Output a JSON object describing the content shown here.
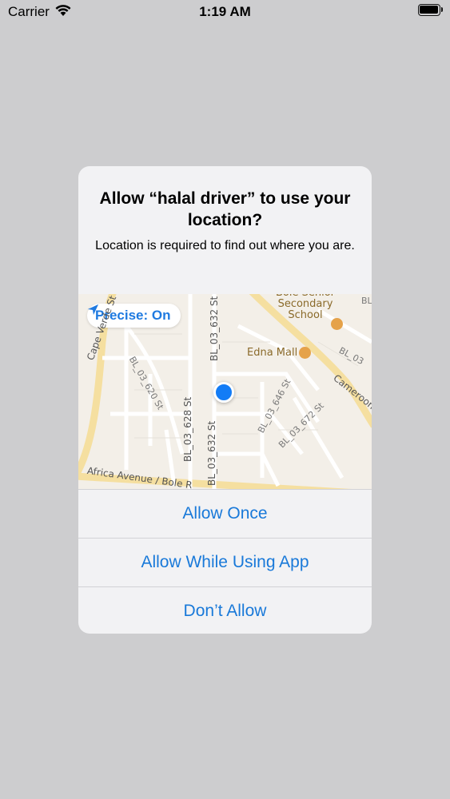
{
  "status_bar": {
    "carrier": "Carrier",
    "time": "1:19 AM",
    "icons": [
      "wifi-icon",
      "battery-icon"
    ]
  },
  "alert": {
    "title": "Allow “halal driver” to use your location?",
    "message": "Location is required to find out where you are.",
    "precise_label": "Precise: On",
    "accent_color": "#1979d9",
    "map": {
      "streets": [
        "Cape Verde St",
        "BL_03_620 St",
        "BL_03_628 St",
        "BL_03_632 St",
        "BL_03_632 St",
        "BL_03_646 St",
        "BL_03_672 St",
        "Africa Avenue / Bole R",
        "Cameroon",
        "BL_03",
        "BL"
      ],
      "pois": [
        "Bole Senior Secondary School",
        "Edna Mall"
      ]
    },
    "buttons": {
      "allow_once": "Allow Once",
      "allow_while_using": "Allow While Using App",
      "dont_allow": "Don’t Allow"
    }
  }
}
